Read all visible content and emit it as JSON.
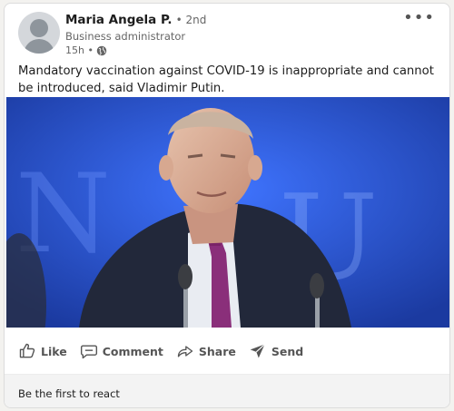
{
  "post": {
    "author": {
      "name": "Maria Angela P.",
      "degree": "• 2nd",
      "headline": "Business administrator",
      "time": "15h •"
    },
    "text": "Mandatory vaccination against COVID-19 is inappropriate and cannot be introduced, said Vladimir Putin.",
    "more_icon": "more-horizontal-icon",
    "image_backdrop_text": "N U"
  },
  "actions": {
    "like_label": "Like",
    "comment_label": "Comment",
    "share_label": "Share",
    "send_label": "Send"
  },
  "reactions": {
    "empty_text": "Be the first to react"
  },
  "colors": {
    "card_bg": "#ffffff",
    "page_bg": "#f3f2ef",
    "text_primary": "#1d1d1d",
    "text_secondary": "#666666",
    "image_blue": "#2a5ae0",
    "footer_bg": "#f3f3f3"
  }
}
